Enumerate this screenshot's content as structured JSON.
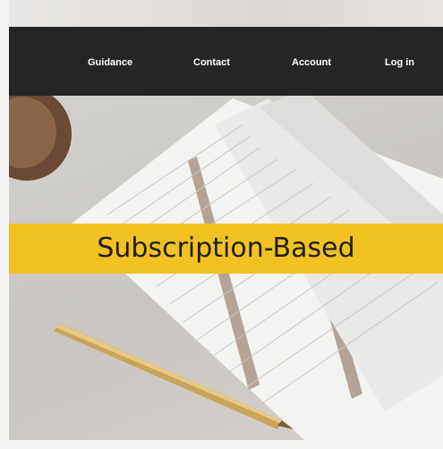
{
  "nav": {
    "items": [
      {
        "label": "Guidance"
      },
      {
        "label": "Contact"
      },
      {
        "label": "Account"
      },
      {
        "label": "Log in"
      }
    ]
  },
  "hero": {
    "banner_text": "Subscription-Based",
    "image": "desk-with-paper-forms-and-gold-pen"
  },
  "colors": {
    "navbar": "#252525",
    "banner": "#f2c222",
    "nav_text": "#ffffff",
    "banner_text": "#1f1f1f"
  }
}
